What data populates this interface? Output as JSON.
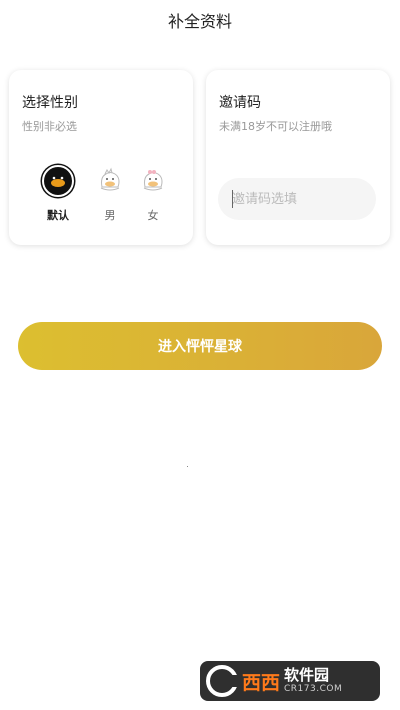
{
  "header": {
    "title": "补全资料"
  },
  "gender_card": {
    "title": "选择性别",
    "subtitle": "性别非必选",
    "options": [
      {
        "label": "默认",
        "icon": "black-duck-avatar-icon",
        "selected": true
      },
      {
        "label": "男",
        "icon": "male-duck-avatar-icon",
        "selected": false
      },
      {
        "label": "女",
        "icon": "female-duck-avatar-icon",
        "selected": false
      }
    ]
  },
  "invite_card": {
    "title": "邀请码",
    "subtitle": "未满18岁不可以注册哦",
    "input_placeholder": "邀请码选填",
    "input_value": ""
  },
  "actions": {
    "enter_label": "进入怦怦星球"
  },
  "colors": {
    "button_gradient_start": "#dcbf30",
    "button_gradient_end": "#d9a63a",
    "watermark_bg": "#2f2f2f",
    "watermark_brand": "#ff7a1a"
  },
  "watermark": {
    "brand": "西西",
    "name": "软件园",
    "url": "CR173.COM"
  }
}
